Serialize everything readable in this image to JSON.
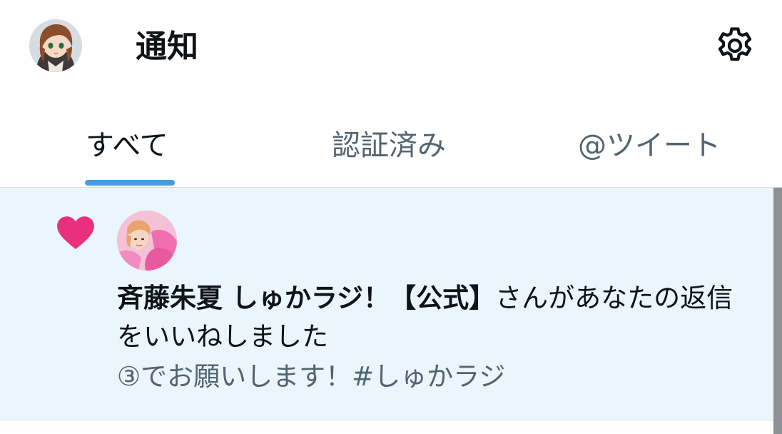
{
  "header": {
    "title": "通知",
    "avatar_icon": "user-avatar",
    "settings_icon": "gear-icon"
  },
  "tabs": [
    {
      "label": "すべて",
      "active": true
    },
    {
      "label": "認証済み",
      "active": false
    },
    {
      "label": "@ツイート",
      "active": false
    }
  ],
  "notification": {
    "type_icon": "heart-icon",
    "user_name": "斉藤朱夏 しゅかラジ！【公式】",
    "action_text": "さんがあなたの返信をいいねしました",
    "snippet": "③でお願いします！#しゅかラジ"
  },
  "colors": {
    "accent": "#4a9ae0",
    "heart": "#e8307f",
    "highlight_bg": "#eaf5fc",
    "secondary_text": "#536471"
  }
}
